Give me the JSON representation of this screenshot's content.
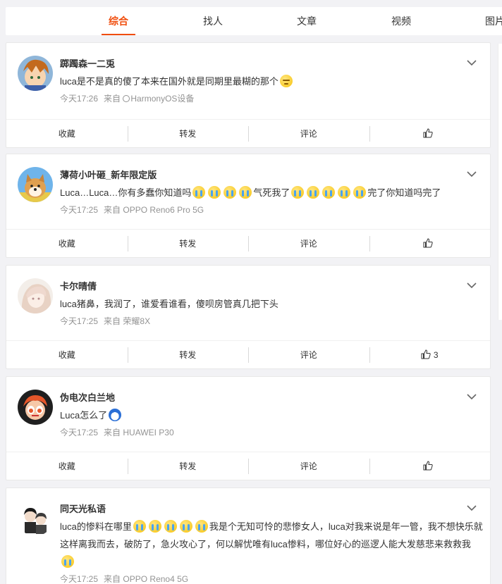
{
  "tabs": [
    {
      "label": "综合",
      "active": true
    },
    {
      "label": "找人",
      "active": false
    },
    {
      "label": "文章",
      "active": false
    },
    {
      "label": "视频",
      "active": false
    },
    {
      "label": "图片",
      "active": false
    }
  ],
  "accent_color": "#f04d0d",
  "posts": [
    {
      "user": "踯躅森一二兎",
      "avatar": "anime-boy-avatar",
      "text": "luca是不是真的傻了本来在国外就是同期里最糊的那个",
      "time": "今天17:26",
      "from": "来自",
      "device": "HarmonyOS设备",
      "likes": ""
    },
    {
      "user": "薄荷小叶砸_新年限定版",
      "avatar": "shiba-dog-avatar",
      "text_a": "Luca…Luca…你有多蠢你知道吗",
      "text_b": "气死我了",
      "text_c": "完了你知道吗完了",
      "time": "今天17:25",
      "from": "来自",
      "device": "OPPO Reno6 Pro 5G",
      "likes": ""
    },
    {
      "user": "卡尔晴倩",
      "avatar": "anime-girl-avatar",
      "text": "luca猪鼻，我润了，谁爱看谁看，傻呗房管真几把下头",
      "time": "今天17:25",
      "from": "来自",
      "device": "荣耀8X",
      "likes": "3"
    },
    {
      "user": "伪电次白兰地",
      "avatar": "cartoon-girl-avatar",
      "text": "Luca怎么了",
      "time": "今天17:25",
      "from": "来自",
      "device": "HUAWEI P30",
      "likes": ""
    },
    {
      "user": "同天光私语",
      "avatar": "anime-pair-avatar",
      "text_a": "luca的惨料在哪里",
      "text_b": "我是个无知可怜的悲惨女人，luca对我来说是年一管，我不想快乐就这样离我而去，破防了，急火攻心了，何以解忧唯有luca惨料，哪位好心的巡逻人能大发慈悲来救救我",
      "time": "今天17:25",
      "from": "来自",
      "device": "OPPO Reno4 5G"
    }
  ],
  "actions": {
    "favorite": "收藏",
    "repost": "转发",
    "comment": "评论"
  }
}
